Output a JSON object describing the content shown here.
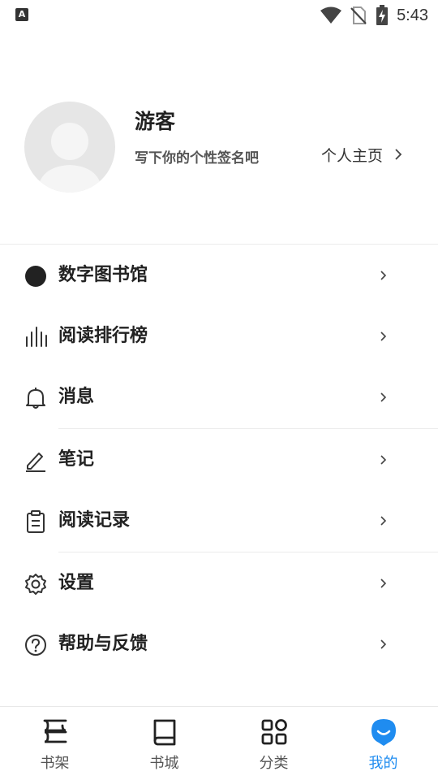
{
  "status_bar": {
    "time": "5:43",
    "left_icon": "A"
  },
  "profile": {
    "name": "游客",
    "signature": "写下你的个性签名吧",
    "homepage_label": "个人主页"
  },
  "menu": {
    "items": [
      {
        "label": "数字图书馆",
        "icon": "circle-icon"
      },
      {
        "label": "阅读排行榜",
        "icon": "bar-chart-icon"
      },
      {
        "label": "消息",
        "icon": "bell-icon"
      },
      {
        "label": "笔记",
        "icon": "pen-icon"
      },
      {
        "label": "阅读记录",
        "icon": "clipboard-icon"
      },
      {
        "label": "设置",
        "icon": "gear-icon"
      },
      {
        "label": "帮助与反馈",
        "icon": "help-icon"
      }
    ]
  },
  "bottom_nav": {
    "items": [
      {
        "label": "书架",
        "icon": "bookshelf-icon",
        "active": false
      },
      {
        "label": "书城",
        "icon": "book-icon",
        "active": false
      },
      {
        "label": "分类",
        "icon": "grid-icon",
        "active": false
      },
      {
        "label": "我的",
        "icon": "face-icon",
        "active": true
      }
    ]
  },
  "colors": {
    "accent": "#1f8cf0",
    "text": "#222222",
    "divider": "#ececec"
  }
}
